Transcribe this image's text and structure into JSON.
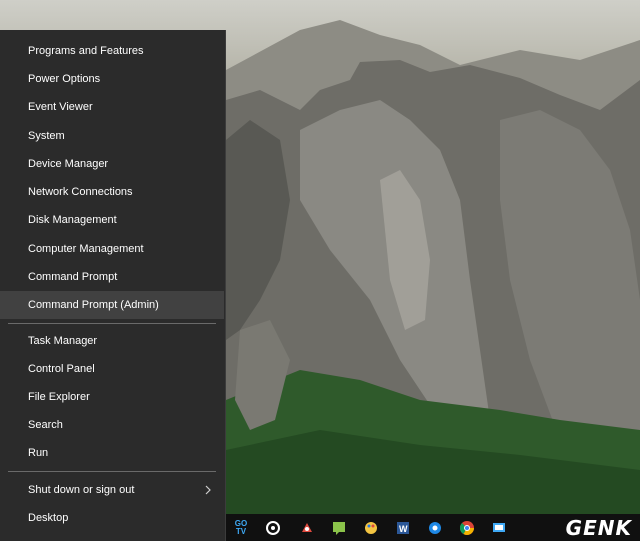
{
  "menu": {
    "items": [
      {
        "label": "Programs and Features"
      },
      {
        "label": "Power Options"
      },
      {
        "label": "Event Viewer"
      },
      {
        "label": "System"
      },
      {
        "label": "Device Manager"
      },
      {
        "label": "Network Connections"
      },
      {
        "label": "Disk Management"
      },
      {
        "label": "Computer Management"
      },
      {
        "label": "Command Prompt"
      },
      {
        "label": "Command Prompt (Admin)"
      },
      {
        "label": "Task Manager"
      },
      {
        "label": "Control Panel"
      },
      {
        "label": "File Explorer"
      },
      {
        "label": "Search"
      },
      {
        "label": "Run"
      },
      {
        "label": "Shut down or sign out"
      },
      {
        "label": "Desktop"
      }
    ]
  },
  "taskbar": {
    "icons": [
      "gotv-icon",
      "groove-icon",
      "app-icon",
      "chat-icon",
      "paint-icon",
      "word-icon",
      "edge-icon",
      "chrome-icon",
      "remote-icon"
    ],
    "gotv_text": "GO TV",
    "brand": "GENK"
  },
  "colors": {
    "menu_bg": "#2b2b2b",
    "menu_hover": "#414141",
    "taskbar_bg": "#101010"
  }
}
